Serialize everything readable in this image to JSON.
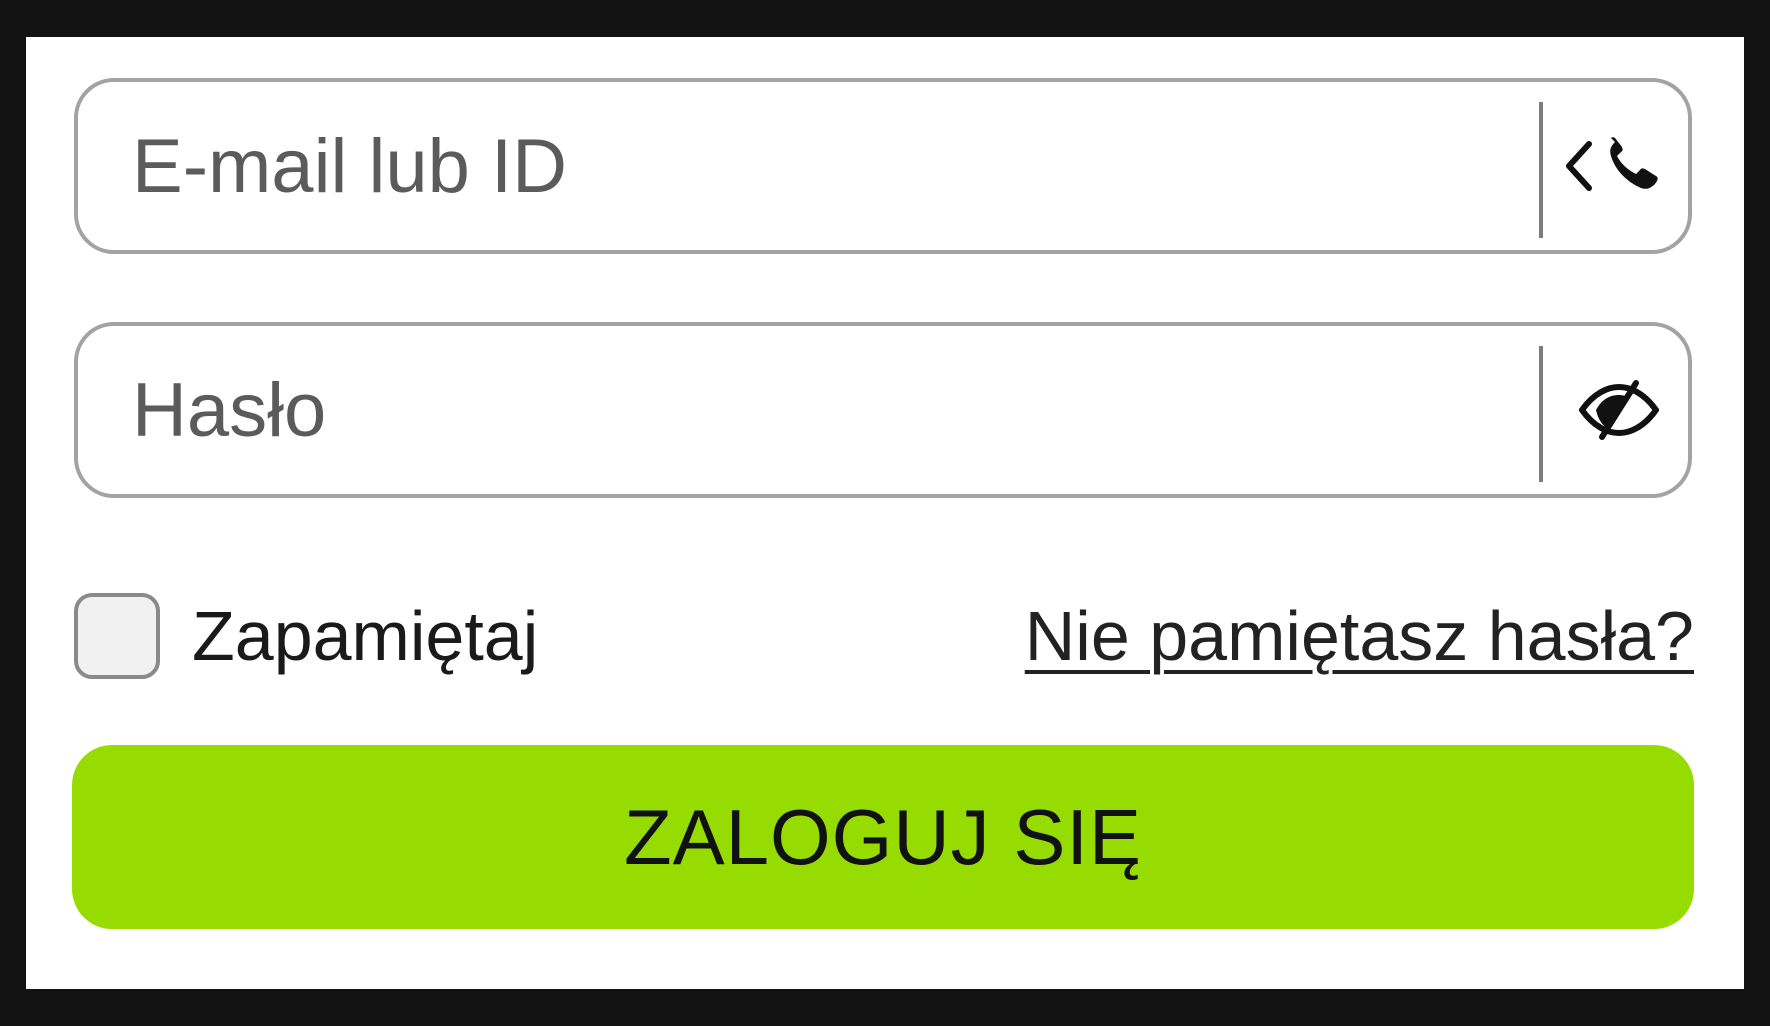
{
  "login_form": {
    "email_field": {
      "placeholder": "E-mail lub ID",
      "value": "",
      "toggle_icon": "chevron-left-phone-icon"
    },
    "password_field": {
      "placeholder": "Hasło",
      "value": "",
      "toggle_icon": "eye-slash-icon"
    },
    "remember": {
      "label": "Zapamiętaj",
      "checked": false
    },
    "forgot_password": {
      "label": "Nie pamiętasz hasła?"
    },
    "submit": {
      "label": "ZALOGUJ SIĘ"
    },
    "colors": {
      "accent": "#97dc00",
      "border": "#a3a3a3",
      "background": "#ffffff",
      "outer": "#121212"
    }
  }
}
